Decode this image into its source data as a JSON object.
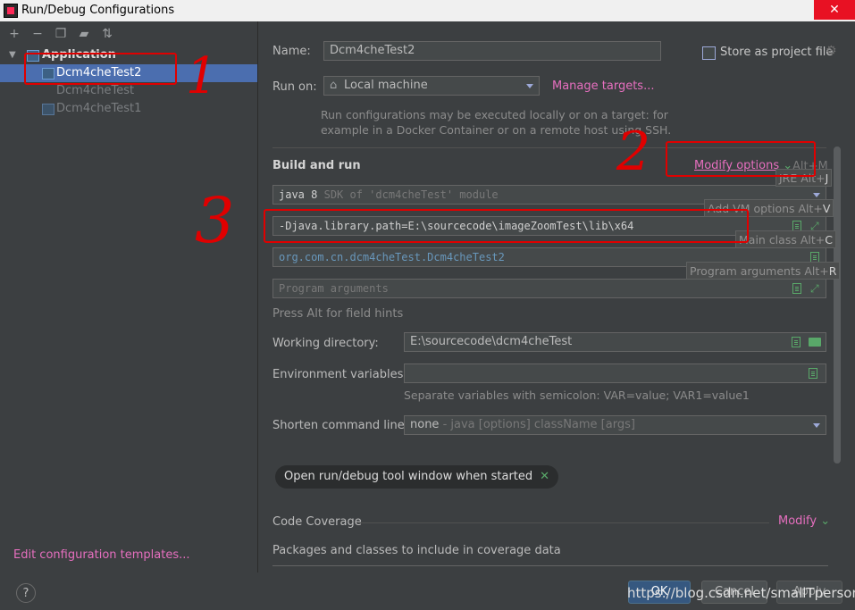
{
  "window": {
    "title": "Run/Debug Configurations",
    "close_glyph": "✕"
  },
  "toolbar": {
    "icons": [
      "add-icon",
      "remove-icon",
      "copy-icon",
      "folder-add-icon",
      "sort-icon"
    ]
  },
  "tree": {
    "group_label": "Application",
    "items": [
      {
        "label": "Dcm4cheTest2"
      },
      {
        "label": "Dcm4cheTest"
      },
      {
        "label": "Dcm4cheTest1"
      }
    ]
  },
  "edit_templates_link": "Edit configuration templates...",
  "form": {
    "name_label": "Name:",
    "name_value": "Dcm4cheTest2",
    "store_label": "Store as project file",
    "run_on_label": "Run on:",
    "run_on_value": "Local machine",
    "manage_targets": "Manage targets...",
    "run_on_hint_1": "Run configurations may be executed locally or on a target: for",
    "run_on_hint_2": "example in a Docker Container or on a remote host using SSH.",
    "build_run_header": "Build and run",
    "modify_options": "Modify options",
    "modify_shortcut": "Alt+M",
    "jre_value": "java 8",
    "jre_hint": "SDK of 'dcm4cheTest' module",
    "vm_options_value": "-Djava.library.path=E:\\sourcecode\\imageZoomTest\\lib\\x64",
    "main_class_value": "org.com.cn.dcm4cheTest.Dcm4cheTest2",
    "program_args_placeholder": "Program arguments",
    "field_hints": "Press Alt for field hints",
    "working_dir_label": "Working directory:",
    "working_dir_value": "E:\\sourcecode\\dcm4cheTest",
    "env_vars_label": "Environment variables:",
    "env_vars_hint": "Separate variables with semicolon: VAR=value; VAR1=value1",
    "shorten_label": "Shorten command line:",
    "shorten_value": "none",
    "shorten_hint": "- java [options] className [args]",
    "open_tool_window_chip": "Open run/debug tool window when started",
    "code_coverage_label": "Code Coverage",
    "coverage_modify": "Modify",
    "packages_label": "Packages and classes to include in coverage data"
  },
  "tooltips": {
    "jre": {
      "text": "JRE Alt+",
      "key": "J"
    },
    "vm": {
      "text": "Add VM options Alt+",
      "key": "V"
    },
    "main": {
      "text": "Main class Alt+",
      "key": "C"
    },
    "args": {
      "text": "Program arguments Alt+",
      "key": "R"
    }
  },
  "buttons": {
    "help": "?",
    "ok": "OK",
    "cancel": "Cancel",
    "apply": "Apply"
  },
  "watermark": "https://blog.csdn.net/smallTperson",
  "annotations": {
    "n1": "1",
    "n2": "2",
    "n3": "3"
  },
  "colors": {
    "accent_link": "#e66fbf",
    "selection": "#4b6eaf",
    "annotation": "#e00000"
  }
}
